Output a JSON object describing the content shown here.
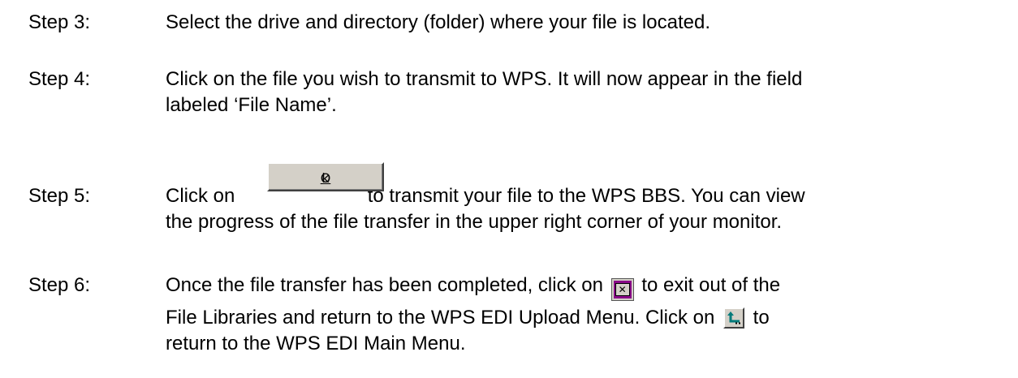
{
  "steps": [
    {
      "label": "Step 3:",
      "lines": [
        "Select the drive and directory (folder) where your file is located."
      ]
    },
    {
      "label": "Step 4:",
      "lines": [
        "Click on the file you wish to transmit to WPS. It will now appear in the field",
        "labeled ‘File Name’."
      ]
    },
    {
      "label": "Step 5:",
      "line1_before": "Click on",
      "line1_after": "to transmit your file to the WPS BBS.  You can view",
      "line2": "the progress of the file transfer in the upper right corner of your monitor.",
      "button": {
        "mnemonic": "O",
        "rest": "k"
      }
    },
    {
      "label": "Step 6:",
      "line1_before": "Once the file transfer has been completed, click on",
      "line1_after": "to exit out of the",
      "line2_before": "File Libraries and return to the WPS EDI Upload Menu.  Click on",
      "line2_after": "to",
      "line3": "return to the WPS EDI Main Menu.",
      "close_icon_glyph": "✕"
    }
  ]
}
